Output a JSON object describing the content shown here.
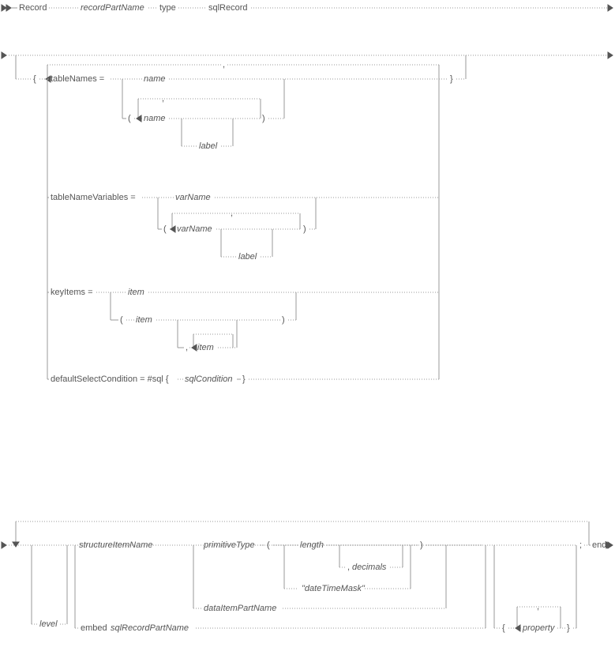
{
  "diagram": {
    "line1": {
      "record": "Record",
      "recordPartName": "recordPartName",
      "type": "type",
      "sqlRecord": "sqlRecord"
    },
    "props": {
      "open_brace": "{",
      "close_brace": "}",
      "comma": ",",
      "tableNames": {
        "label": "tableNames =",
        "name": "name",
        "open_paren": "(",
        "close_paren": ")",
        "lbl": "label"
      },
      "tableNameVariables": {
        "label": "tableNameVariables =",
        "varName": "varName",
        "open_paren": "(",
        "close_paren": ")",
        "lbl": "label"
      },
      "keyItems": {
        "label": "keyItems =",
        "item": "item",
        "open_paren": "(",
        "close_paren": ")",
        "comma": ","
      },
      "defaultSelect": {
        "label": "defaultSelectCondition = #sql {",
        "sqlCondition": "sqlCondition",
        "close_brace": "}"
      }
    },
    "items": {
      "level": "level",
      "structureItemName": "structureItemName",
      "primitiveType": "primitiveType",
      "open_paren": "(",
      "length": "length",
      "decimals_comma": ",",
      "decimals": "decimals",
      "dateTimeMask": "\"dateTimeMask\"",
      "close_paren": ")",
      "dataItemPartName": "dataItemPartName",
      "embed": "embed",
      "sqlRecordPartName": "sqlRecordPartName",
      "open_brace": "{",
      "property": "property",
      "props_comma": ",",
      "close_brace": "}",
      "semicolon": ";",
      "end": "end"
    }
  }
}
